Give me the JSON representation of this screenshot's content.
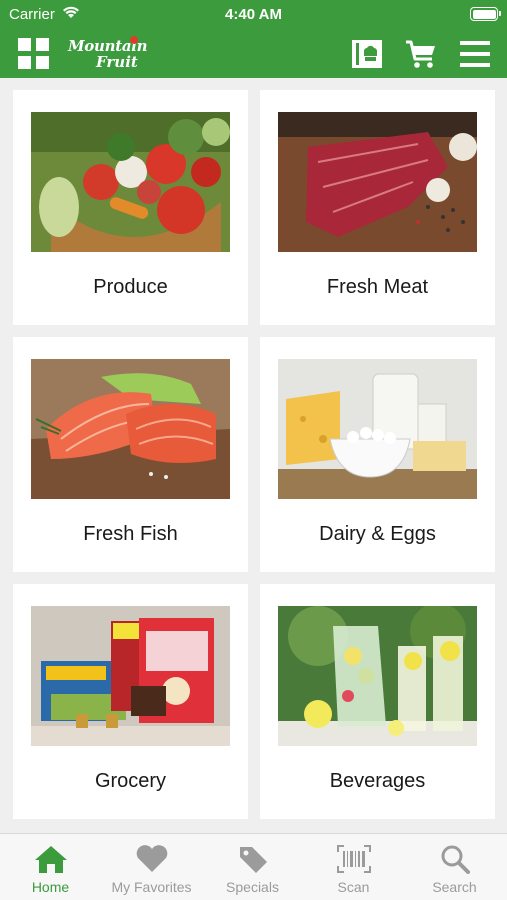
{
  "status_bar": {
    "carrier": "Carrier",
    "time": "4:40 AM"
  },
  "header": {
    "logo_line1": "Mountain",
    "logo_line2": "Fruit",
    "brand_color": "#3c9b3c"
  },
  "categories": [
    {
      "label": "Produce",
      "image": "vegetable-basket"
    },
    {
      "label": "Fresh Meat",
      "image": "raw-steak"
    },
    {
      "label": "Fresh Fish",
      "image": "salmon-fillet"
    },
    {
      "label": "Dairy & Eggs",
      "image": "cheese-milk"
    },
    {
      "label": "Grocery",
      "image": "packaged-goods"
    },
    {
      "label": "Beverages",
      "image": "lemonade-pitcher"
    }
  ],
  "tabs": [
    {
      "label": "Home",
      "icon": "home-icon",
      "active": true
    },
    {
      "label": "My Favorites",
      "icon": "heart-icon",
      "active": false
    },
    {
      "label": "Specials",
      "icon": "tag-icon",
      "active": false
    },
    {
      "label": "Scan",
      "icon": "barcode-icon",
      "active": false
    },
    {
      "label": "Search",
      "icon": "search-icon",
      "active": false
    }
  ]
}
